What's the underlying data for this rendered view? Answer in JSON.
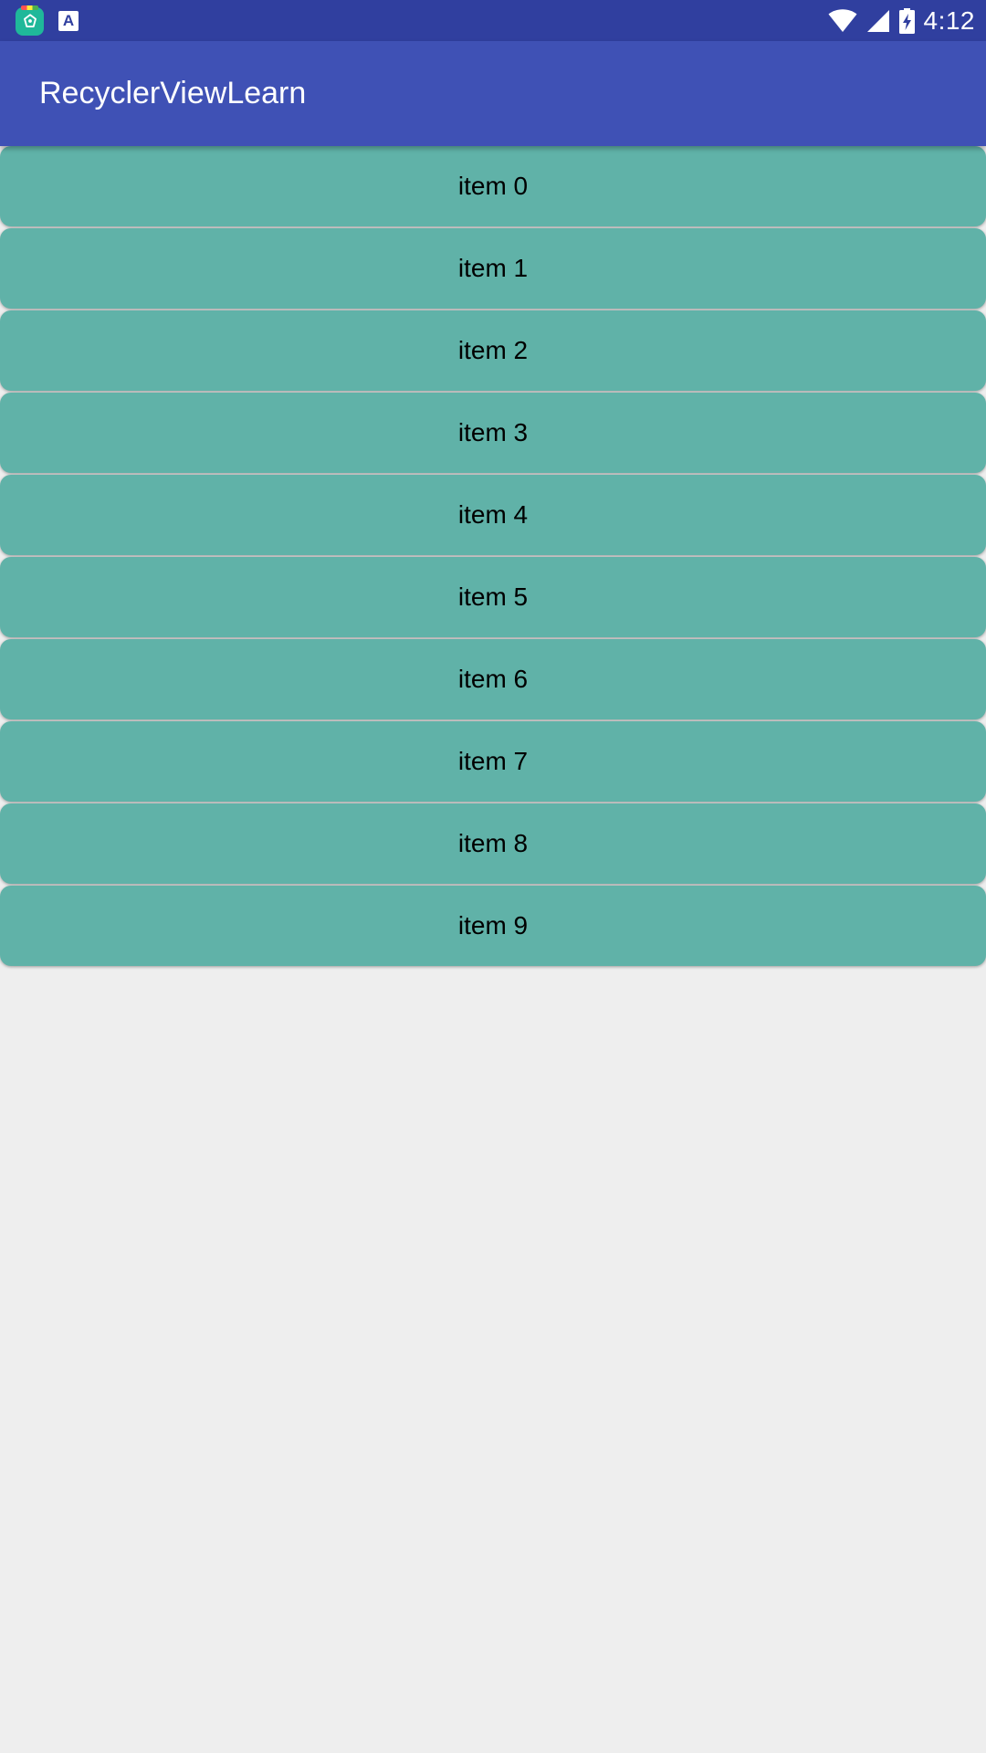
{
  "status_bar": {
    "time": "4:12",
    "notification_icons": [
      "app-store-icon",
      "a-letter-icon"
    ],
    "a_icon_label": "A",
    "system_icons": [
      "wifi-icon",
      "cellular-signal-icon",
      "battery-charging-icon"
    ]
  },
  "app_bar": {
    "title": "RecyclerViewLearn",
    "color": "#3f51b5"
  },
  "list": {
    "item_color": "#60b2a8",
    "items": [
      {
        "label": "item 0"
      },
      {
        "label": "item 1"
      },
      {
        "label": "item 2"
      },
      {
        "label": "item 3"
      },
      {
        "label": "item 4"
      },
      {
        "label": "item 5"
      },
      {
        "label": "item 6"
      },
      {
        "label": "item 7"
      },
      {
        "label": "item 8"
      },
      {
        "label": "item 9"
      }
    ]
  }
}
